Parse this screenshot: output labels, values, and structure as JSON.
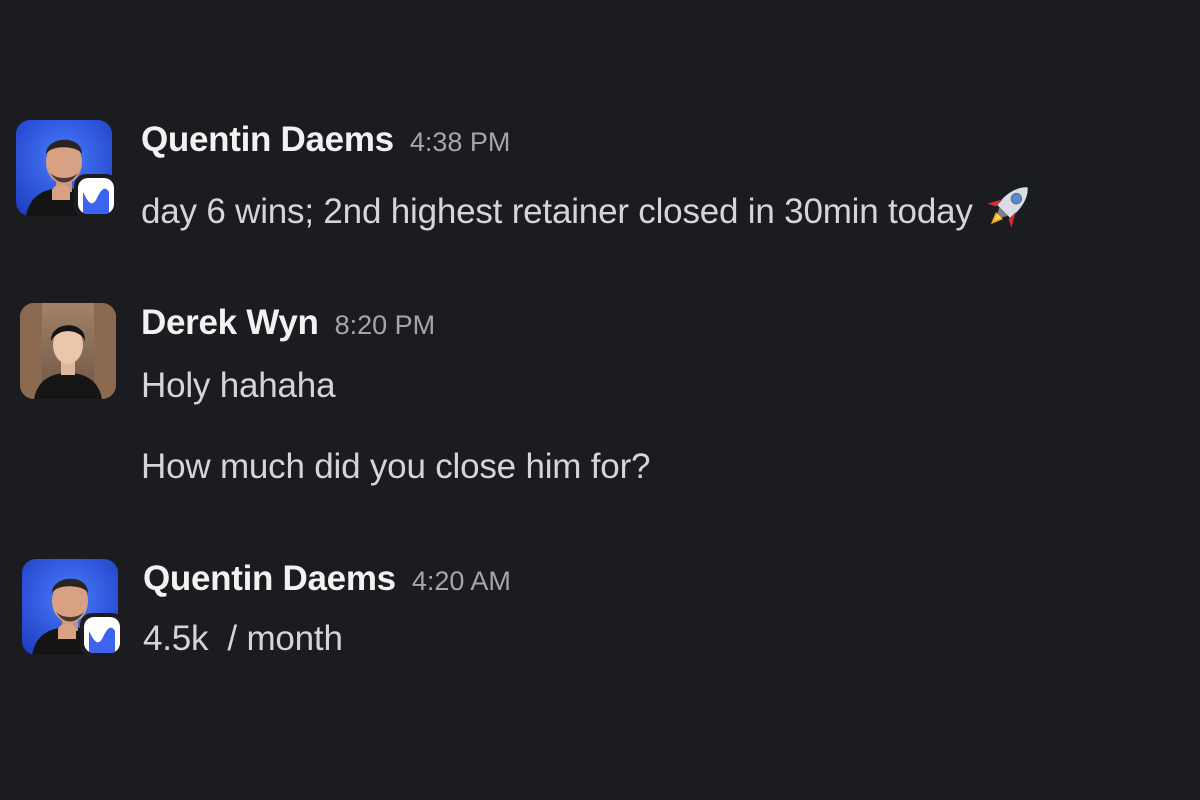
{
  "messages": [
    {
      "author": "Quentin Daems",
      "time": "4:38 PM",
      "avatar": "person-avatar-quentin",
      "badge": "app-badge-icon",
      "lines": [
        "day 6 wins; 2nd highest retainer closed in 30min today"
      ],
      "emoji": "rocket-icon"
    },
    {
      "author": "Derek Wyn",
      "time": "8:20 PM",
      "avatar": "person-avatar-derek",
      "lines": [
        "Holy hahaha",
        "How much did you close him for?"
      ]
    },
    {
      "author": "Quentin Daems",
      "time": "4:20 AM",
      "avatar": "person-avatar-quentin",
      "badge": "app-badge-icon",
      "lines": [
        "4.5k  / month"
      ]
    }
  ],
  "colors": {
    "background": "#1b1c20",
    "author": "#f2f2f2",
    "timestamp": "#a5a6a8",
    "body_text": "#d4d5d6",
    "badge_accent": "#3d64f0"
  }
}
